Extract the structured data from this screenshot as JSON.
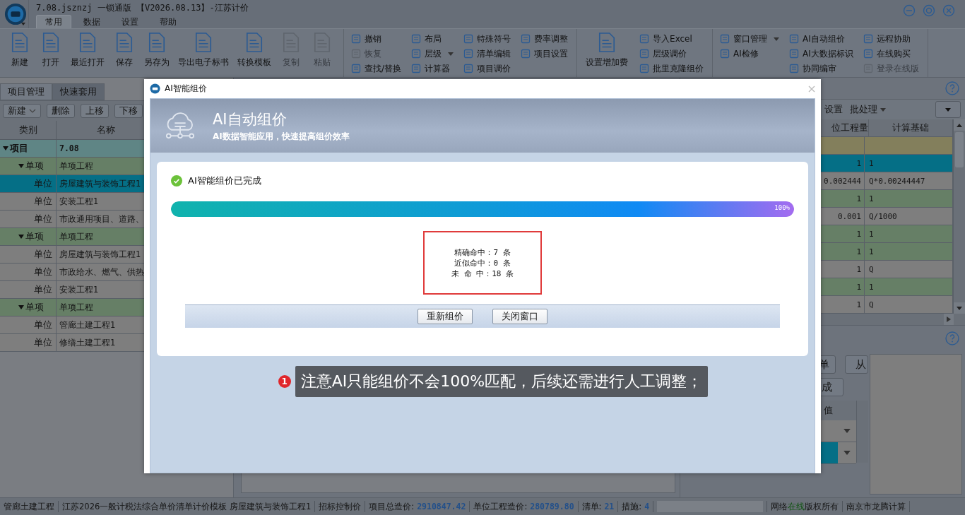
{
  "window": {
    "title": "7.08.jsznzj 一锁通版 【V2026.08.13】-江苏计价"
  },
  "menu_tabs": [
    {
      "label": "常用",
      "selected": true
    },
    {
      "label": "数据",
      "selected": false
    },
    {
      "label": "设置",
      "selected": false
    },
    {
      "label": "帮助",
      "selected": false
    }
  ],
  "ribbon": {
    "groups": [
      {
        "columns": [
          {
            "kind": "large",
            "items": [
              {
                "label": "新建",
                "disabled": false
              },
              {
                "label": "打开",
                "disabled": false
              },
              {
                "label": "最近打开",
                "disabled": false
              },
              {
                "label": "保存",
                "disabled": false
              },
              {
                "label": "另存为",
                "disabled": false
              },
              {
                "label": "导出电子标书",
                "disabled": false
              },
              {
                "label": "转换模板",
                "disabled": false
              },
              {
                "label": "复制",
                "disabled": true
              },
              {
                "label": "粘贴",
                "disabled": true
              }
            ]
          }
        ]
      },
      {
        "columns": [
          {
            "kind": "small",
            "items": [
              {
                "label": "撤销",
                "disabled": false,
                "dropdown": false
              },
              {
                "label": "恢复",
                "disabled": true,
                "dropdown": false
              },
              {
                "label": "查找/替换",
                "disabled": false,
                "dropdown": false
              }
            ]
          },
          {
            "kind": "small",
            "items": [
              {
                "label": "布局",
                "disabled": false,
                "dropdown": false
              },
              {
                "label": "层级",
                "disabled": false,
                "dropdown": true
              },
              {
                "label": "计算器",
                "disabled": false,
                "dropdown": false
              }
            ]
          },
          {
            "kind": "small",
            "items": [
              {
                "label": "特殊符号",
                "disabled": false,
                "dropdown": false
              },
              {
                "label": "清单编辑",
                "disabled": false,
                "dropdown": false
              },
              {
                "label": "项目调价",
                "disabled": false,
                "dropdown": false
              }
            ]
          },
          {
            "kind": "small",
            "items": [
              {
                "label": "费率调整",
                "disabled": false,
                "dropdown": false
              },
              {
                "label": "项目设置",
                "disabled": false,
                "dropdown": false
              }
            ]
          }
        ]
      },
      {
        "columns": [
          {
            "kind": "large",
            "items": [
              {
                "label": "设置增加费",
                "disabled": false
              }
            ]
          },
          {
            "kind": "small",
            "items": [
              {
                "label": "导入Excel",
                "disabled": false,
                "dropdown": false
              },
              {
                "label": "层级调价",
                "disabled": false,
                "dropdown": false
              },
              {
                "label": "批里克隆组价",
                "disabled": false,
                "dropdown": false
              }
            ]
          }
        ]
      },
      {
        "columns": [
          {
            "kind": "small",
            "items": [
              {
                "label": "窗口管理",
                "disabled": false,
                "dropdown": true
              },
              {
                "label": "AI检修",
                "disabled": false,
                "dropdown": false
              }
            ]
          },
          {
            "kind": "small",
            "items": [
              {
                "label": "AI自动组价",
                "disabled": false,
                "dropdown": false
              },
              {
                "label": "AI大数据标识",
                "disabled": false,
                "dropdown": false
              },
              {
                "label": "协同编审",
                "disabled": false,
                "dropdown": false
              }
            ]
          },
          {
            "kind": "small",
            "items": [
              {
                "label": "远程协助",
                "disabled": false,
                "dropdown": false
              },
              {
                "label": "在线购买",
                "disabled": false,
                "dropdown": false
              },
              {
                "label": "登录在线版",
                "disabled": true,
                "dropdown": false
              }
            ]
          }
        ]
      }
    ]
  },
  "left_panel": {
    "tabs": [
      {
        "label": "项目管理",
        "selected": true
      },
      {
        "label": "快速套用",
        "selected": false
      }
    ],
    "toolbar": [
      {
        "label": "新建",
        "dropdown": true
      },
      {
        "label": "删除",
        "dropdown": false
      },
      {
        "label": "上移",
        "dropdown": false
      },
      {
        "label": "下移",
        "dropdown": false
      }
    ],
    "columns": [
      "类别",
      "名称"
    ],
    "nodes": [
      {
        "category": "项目",
        "name": "7.08",
        "expanded": true,
        "selected": false,
        "children": [
          {
            "category": "单项",
            "name": "单项工程",
            "expanded": true,
            "selected": false,
            "children": [
              {
                "category": "单位",
                "name": "房屋建筑与装饰工程1",
                "selected": true
              },
              {
                "category": "单位",
                "name": "安装工程1",
                "selected": false
              },
              {
                "category": "单位",
                "name": "市政通用项目、道路、",
                "selected": false
              }
            ]
          },
          {
            "category": "单项",
            "name": "单项工程",
            "expanded": true,
            "selected": false,
            "children": [
              {
                "category": "单位",
                "name": "房屋建筑与装饰工程1",
                "selected": false
              },
              {
                "category": "单位",
                "name": "市政给水、燃气、供热",
                "selected": false
              },
              {
                "category": "单位",
                "name": "安装工程1",
                "selected": false
              }
            ]
          },
          {
            "category": "单项",
            "name": "单项工程",
            "expanded": true,
            "selected": false,
            "children": [
              {
                "category": "单位",
                "name": "管廊土建工程1",
                "selected": false
              },
              {
                "category": "单位",
                "name": "修缮土建工程1",
                "selected": false
              }
            ]
          }
        ]
      }
    ]
  },
  "right_panel": {
    "toolbar": [
      {
        "label": "设置",
        "dropdown": false
      },
      {
        "label": "批处理",
        "dropdown": true
      }
    ],
    "columns": [
      "位工程量",
      "计算基础"
    ],
    "rows": [
      {
        "color": "#837f5c"
      },
      {
        "quantity": "1",
        "basis": "1",
        "color": "#056f86"
      },
      {
        "quantity": "0.002444",
        "basis": "Q*0.00244447",
        "color": "#7e7e7e"
      },
      {
        "quantity": "1",
        "basis": "1",
        "color": "#667f66"
      },
      {
        "quantity": "0.001",
        "basis": "Q/1000",
        "color": "#7e7e7e"
      },
      {
        "quantity": "1",
        "basis": "1",
        "color": "#667f66"
      },
      {
        "quantity": "1",
        "basis": "1",
        "color": "#667f66"
      },
      {
        "quantity": "1",
        "basis": "Q",
        "color": "#7e7e7e"
      },
      {
        "quantity": "1",
        "basis": "1",
        "color": "#667f66"
      },
      {
        "quantity": "1",
        "basis": "Q",
        "color": "#7e7e7e"
      }
    ],
    "lower_buttons": [
      "单",
      "从",
      "成"
    ],
    "property_column": "值",
    "property_rows": [
      {
        "selected": false
      },
      {
        "selected": true
      }
    ]
  },
  "dialog": {
    "title": "AI智能组价",
    "header": {
      "title": "AI自动组价",
      "subtitle": "AI数据智能应用，快速提高组价效率"
    },
    "status": "AI智能组价已完成",
    "progress": {
      "level": 1,
      "reading": "100%"
    },
    "results": [
      "精确命中：7 条",
      "近似命中：0 条",
      "未 命 中：18 条"
    ],
    "buttons": [
      "重新组价",
      "关闭窗口"
    ]
  },
  "annotation": {
    "number": "1",
    "text": "注意AI只能组价不会100%匹配，后续还需进行人工调整；"
  },
  "status_bar": [
    {
      "kind": "text",
      "text": "管廊土建工程"
    },
    {
      "kind": "text",
      "text": "江苏2026一般计税法综合单价清单计价模板 房屋建筑与装饰工程1"
    },
    {
      "kind": "text",
      "text": "招标控制价"
    },
    {
      "kind": "value",
      "label": "项目总造价:",
      "value": "2910847.42"
    },
    {
      "kind": "value",
      "label": "单位工程造价:",
      "value": "280789.80"
    },
    {
      "kind": "value",
      "label": "清单:",
      "value": "21"
    },
    {
      "kind": "value",
      "label": "措施:",
      "value": "4"
    },
    {
      "kind": "blank"
    },
    {
      "kind": "online",
      "before": "网络",
      "highlight": "在线",
      "after": "版权所有"
    },
    {
      "kind": "text",
      "text": "南京市龙腾计算"
    }
  ]
}
